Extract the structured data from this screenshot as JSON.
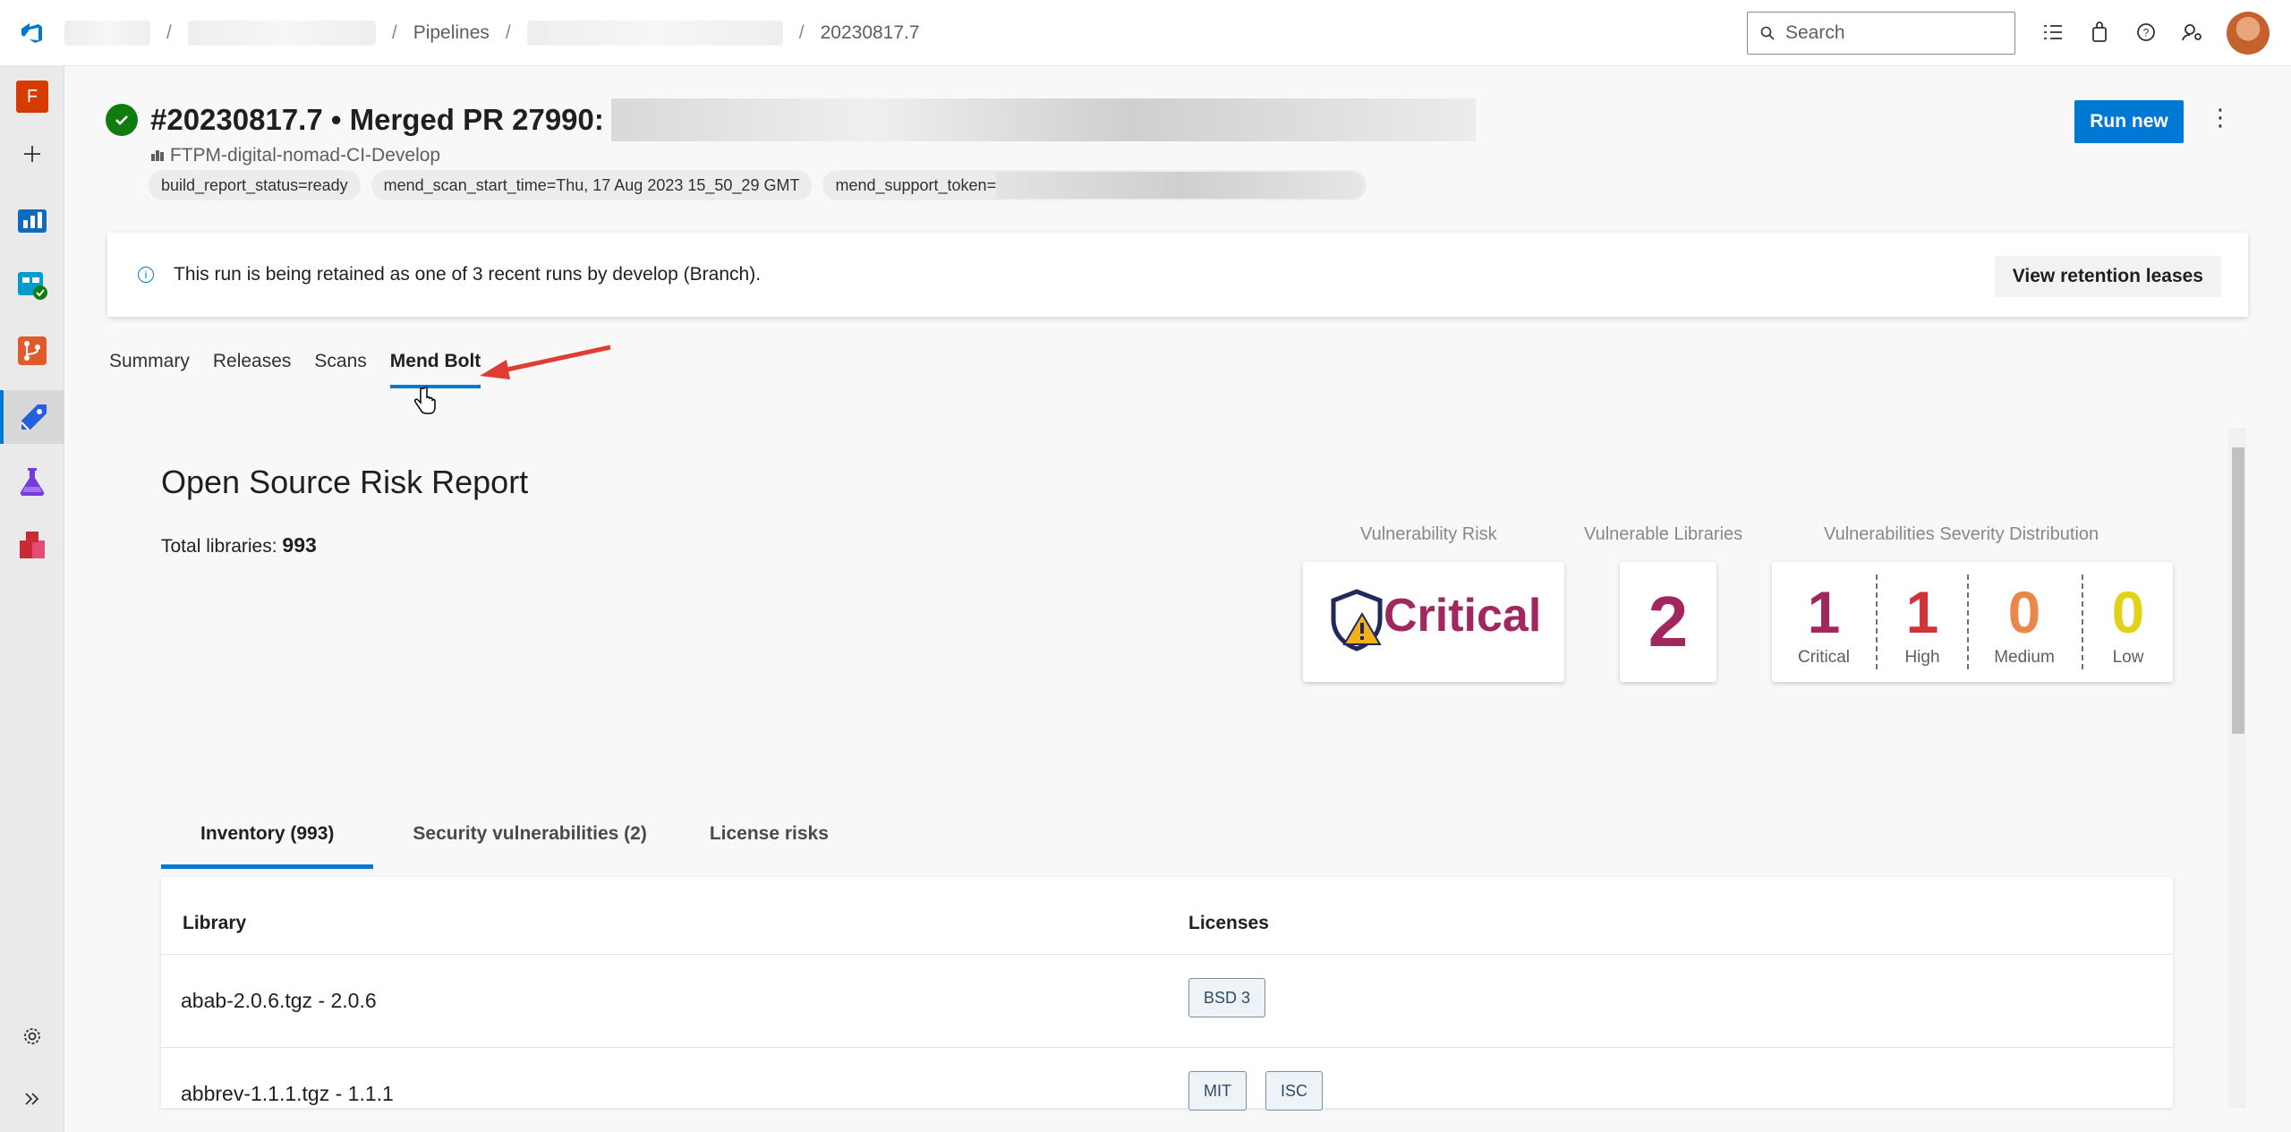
{
  "breadcrumb": {
    "pipelines": "Pipelines",
    "run": "20230817.7"
  },
  "search": {
    "placeholder": "Search"
  },
  "org": {
    "initial": "F"
  },
  "run": {
    "title": "#20230817.7 • Merged PR 27990:",
    "pipeline": "FTPM-digital-nomad-CI-Develop",
    "tags": [
      "build_report_status=ready",
      "mend_scan_start_time=Thu, 17 Aug 2023 15_50_29 GMT",
      "mend_support_token="
    ],
    "run_new": "Run new"
  },
  "banner": {
    "text": "This run is being retained as one of 3 recent runs by develop (Branch).",
    "button": "View retention leases"
  },
  "tabs": [
    "Summary",
    "Releases",
    "Scans",
    "Mend Bolt"
  ],
  "report": {
    "title": "Open Source Risk Report",
    "total_label": "Total libraries:",
    "total_value": "993",
    "vuln_risk_label": "Vulnerability Risk",
    "vuln_risk_value": "Critical",
    "vuln_libs_label": "Vulnerable Libraries",
    "vuln_libs_value": "2",
    "severity_label": "Vulnerabilities Severity Distribution",
    "severity": [
      {
        "count": "1",
        "label": "Critical",
        "color": "#a0285f"
      },
      {
        "count": "1",
        "label": "High",
        "color": "#d13438"
      },
      {
        "count": "0",
        "label": "Medium",
        "color": "#e8884a"
      },
      {
        "count": "0",
        "label": "Low",
        "color": "#e3d21a"
      }
    ]
  },
  "sub_tabs": [
    "Inventory (993)",
    "Security vulnerabilities (2)",
    "License risks"
  ],
  "table": {
    "headers": {
      "library": "Library",
      "licenses": "Licenses"
    },
    "rows": [
      {
        "library": "abab-2.0.6.tgz - 2.0.6",
        "licenses": [
          "BSD 3"
        ]
      },
      {
        "library": "abbrev-1.1.1.tgz - 1.1.1",
        "licenses": [
          "MIT",
          "ISC"
        ]
      }
    ]
  }
}
